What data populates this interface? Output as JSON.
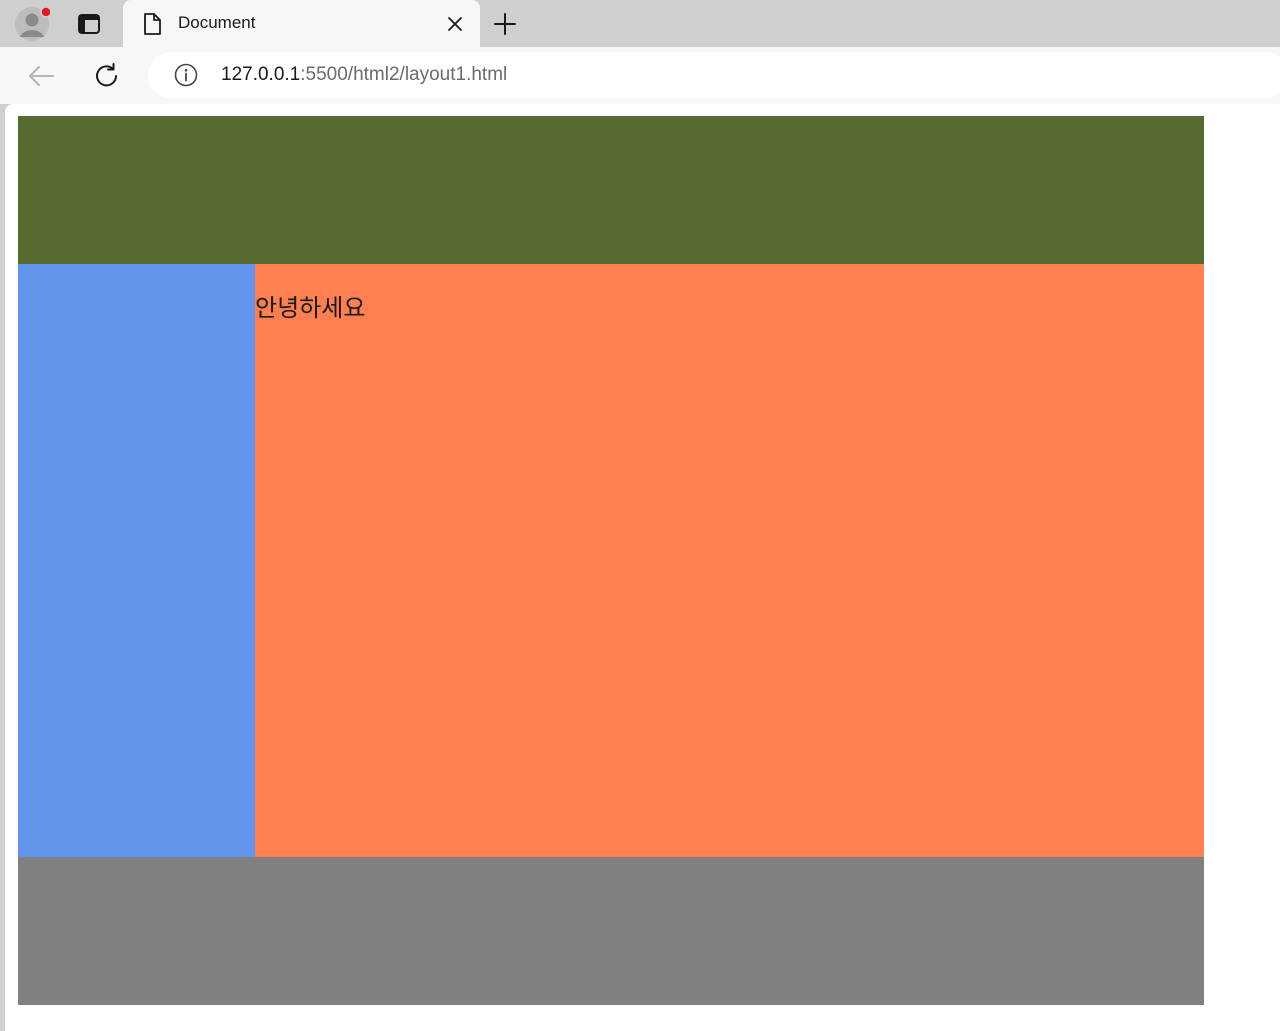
{
  "browser": {
    "tab": {
      "title": "Document",
      "icon": "document-icon",
      "close_icon": "close-icon"
    },
    "toolbar": {
      "back_icon": "back-arrow-icon",
      "reload_icon": "reload-icon",
      "site_info_icon": "info-icon",
      "url_host": "127.0.0.1",
      "url_rest": ":5500/html2/layout1.html"
    },
    "profile_icon": "profile-avatar-icon",
    "new_tab_icon": "plus-icon"
  },
  "page": {
    "content_text": "안녕하세요"
  },
  "colors": {
    "header": "#556B2F",
    "sidebar": "#6495ED",
    "content": "#FF7F50",
    "footer": "#808080"
  }
}
